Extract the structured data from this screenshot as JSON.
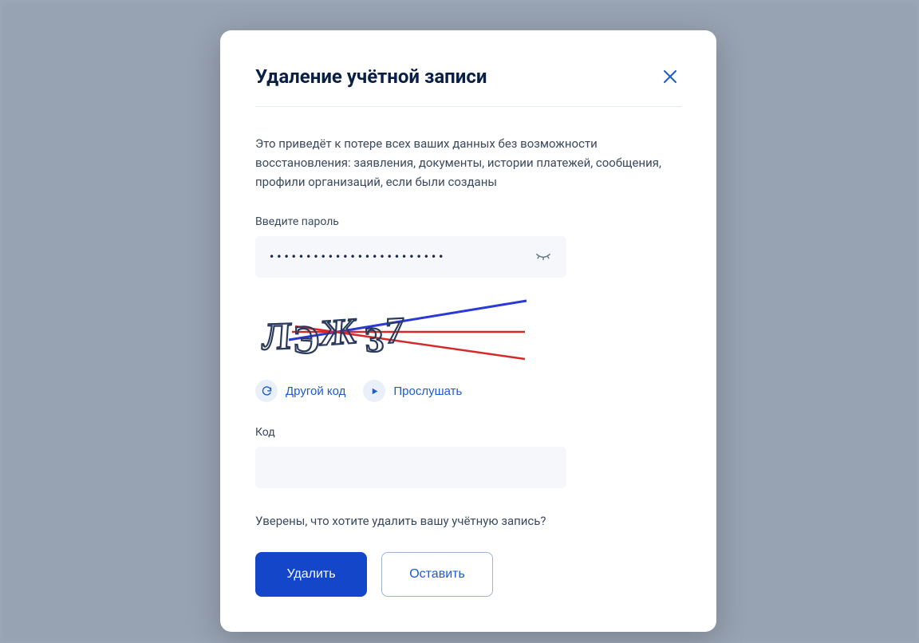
{
  "modal": {
    "title": "Удаление учётной записи",
    "description": "Это приведёт к потере всех ваших данных без возможности восстановления: заявления, документы, истории платежей, сообщения, профили организаций, если были созданы",
    "password": {
      "label": "Введите пароль",
      "value": "••••••••••••••••••••••••"
    },
    "captcha": {
      "text": "ЛЭЖ З7",
      "refresh_label": "Другой код",
      "listen_label": "Прослушать"
    },
    "code": {
      "label": "Код",
      "value": ""
    },
    "confirm_text": "Уверены, что хотите удалить вашу учётную запись?",
    "buttons": {
      "delete": "Удалить",
      "keep": "Оставить"
    }
  },
  "colors": {
    "primary": "#1446c9",
    "link": "#1b5bd6"
  }
}
